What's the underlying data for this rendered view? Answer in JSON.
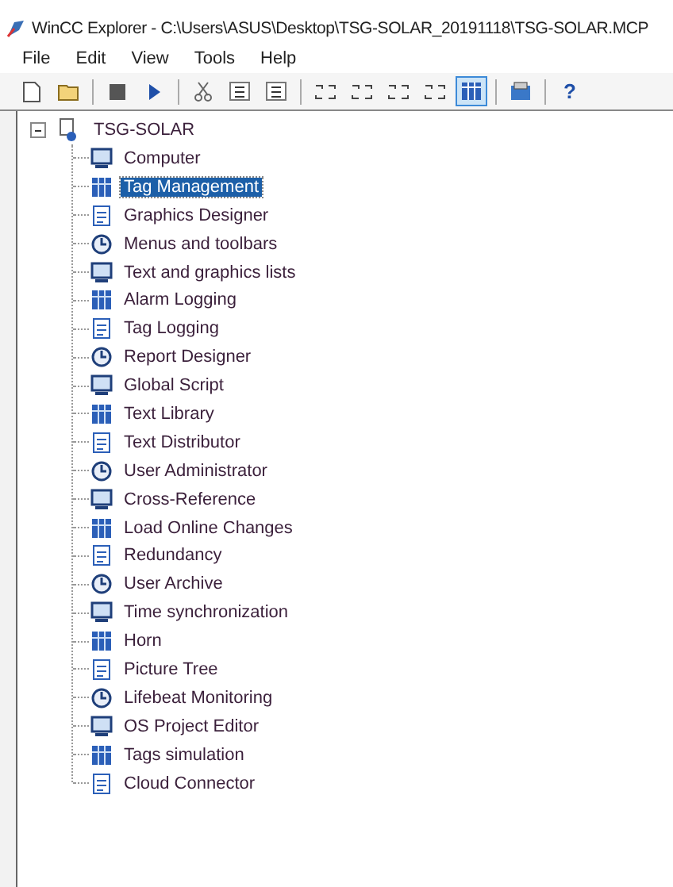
{
  "window": {
    "title": "WinCC Explorer - C:\\Users\\ASUS\\Desktop\\TSG-SOLAR_20191118\\TSG-SOLAR.MCP"
  },
  "menu": [
    "File",
    "Edit",
    "View",
    "Tools",
    "Help"
  ],
  "toolbar": [
    {
      "selected": false
    },
    {
      "selected": false
    },
    {
      "selected": false
    },
    {
      "selected": false
    },
    {
      "selected": false
    },
    {
      "selected": false
    },
    {
      "selected": false
    },
    {
      "selected": false
    },
    {
      "selected": false
    },
    {
      "selected": false
    },
    {
      "selected": false
    },
    {
      "selected": true
    },
    {
      "selected": false
    },
    {
      "selected": false,
      "label": "?"
    }
  ],
  "tree": {
    "label": "TSG-SOLAR",
    "expanded": true,
    "children": [
      {
        "label": "Computer",
        "selected": false
      },
      {
        "label": "Tag Management",
        "selected": true
      },
      {
        "label": "Graphics Designer",
        "selected": false
      },
      {
        "label": "Menus and toolbars",
        "selected": false
      },
      {
        "label": "Text and graphics lists",
        "selected": false
      },
      {
        "label": "Alarm Logging",
        "selected": false
      },
      {
        "label": "Tag Logging",
        "selected": false
      },
      {
        "label": "Report Designer",
        "selected": false
      },
      {
        "label": "Global Script",
        "selected": false
      },
      {
        "label": "Text Library",
        "selected": false
      },
      {
        "label": "Text Distributor",
        "selected": false
      },
      {
        "label": "User Administrator",
        "selected": false
      },
      {
        "label": "Cross-Reference",
        "selected": false
      },
      {
        "label": "Load Online Changes",
        "selected": false
      },
      {
        "label": "Redundancy",
        "selected": false
      },
      {
        "label": "User Archive",
        "selected": false
      },
      {
        "label": "Time synchronization",
        "selected": false
      },
      {
        "label": "Horn",
        "selected": false
      },
      {
        "label": "Picture Tree",
        "selected": false
      },
      {
        "label": "Lifebeat Monitoring",
        "selected": false
      },
      {
        "label": "OS Project Editor",
        "selected": false
      },
      {
        "label": "Tags simulation",
        "selected": false
      },
      {
        "label": "Cloud Connector",
        "selected": false
      }
    ]
  }
}
